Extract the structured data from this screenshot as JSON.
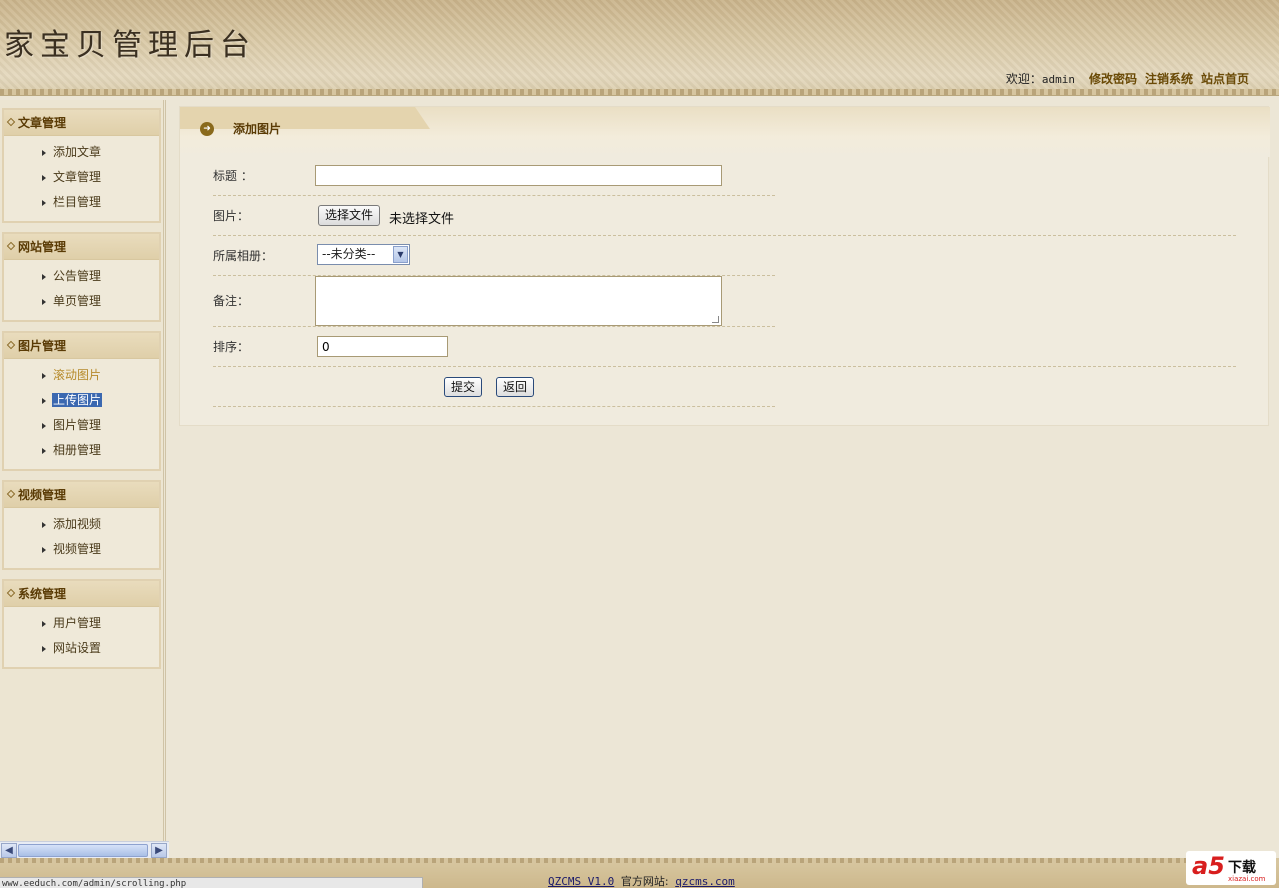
{
  "header": {
    "logo_title": "家宝贝管理后台",
    "welcome_label": "欢迎：",
    "username": "admin",
    "links": [
      "修改密码",
      "注销系统",
      "站点首页"
    ]
  },
  "sidebar": {
    "groups": [
      {
        "title": "文章管理",
        "items": [
          "添加文章",
          "文章管理",
          "栏目管理"
        ]
      },
      {
        "title": "网站管理",
        "items": [
          "公告管理",
          "单页管理"
        ]
      },
      {
        "title": "图片管理",
        "items": [
          "滚动图片",
          "上传图片",
          "图片管理",
          "相册管理"
        ]
      },
      {
        "title": "视频管理",
        "items": [
          "添加视频",
          "视频管理"
        ]
      },
      {
        "title": "系统管理",
        "items": [
          "用户管理",
          "网站设置"
        ]
      }
    ],
    "active_item": "上传图片",
    "hover_item": "滚动图片"
  },
  "panel": {
    "title": "添加图片"
  },
  "form": {
    "title_label": "标题 ：",
    "title_value": "",
    "image_label": "图片：",
    "file_button": "选择文件",
    "file_status": "未选择文件",
    "album_label": "所属相册：",
    "album_selected": "--未分类--",
    "note_label": "备注：",
    "note_value": "",
    "order_label": "排序：",
    "order_value": "0",
    "submit_label": "提交",
    "back_label": "返回"
  },
  "footer": {
    "product": "QZCMS  V1.0",
    "official_label": "官方网站:",
    "official_site": "qzcms.com"
  },
  "status_bar": {
    "url": "www.eeduch.com/admin/scrolling.php"
  },
  "watermark": {
    "brand": "a5",
    "download": "下载",
    "site": "xiazai.com"
  },
  "colors": {
    "accent_text": "#5a3b05",
    "active_bg": "#3b68b0",
    "link_color": "#6a4a06"
  }
}
